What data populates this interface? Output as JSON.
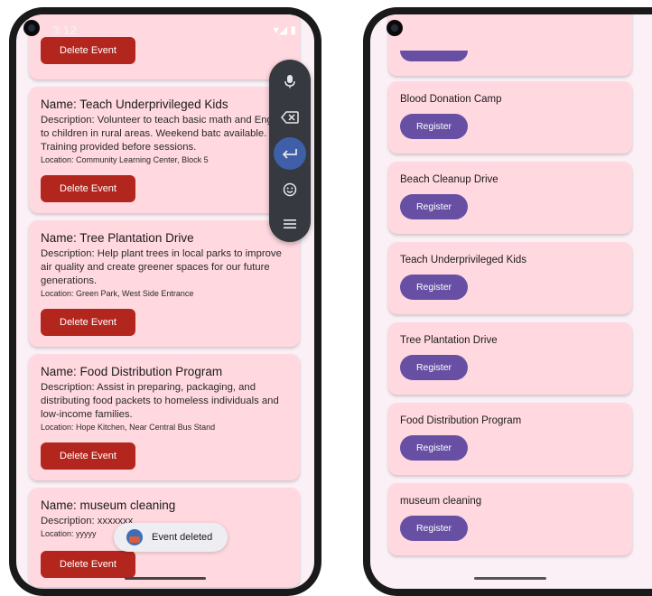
{
  "left": {
    "status_time": "3:12",
    "top_button": "Delete Event",
    "events": [
      {
        "name": "Name: Teach Underprivileged Kids",
        "description": "Description: Volunteer to teach basic math and English to children in rural areas. Weekend batc available. Training provided before sessions.",
        "location": "Location: Community Learning Center, Block 5",
        "button": "Delete Event"
      },
      {
        "name": "Name: Tree Plantation Drive",
        "description": "Description: Help plant trees in local parks to improve air quality and create greener spaces for our future generations.",
        "location": "Location: Green Park, West Side Entrance",
        "button": "Delete Event"
      },
      {
        "name": "Name: Food Distribution Program",
        "description": "Description: Assist in preparing, packaging, and distributing food packets to homeless individuals and low-income families.",
        "location": "Location: Hope Kitchen, Near Central Bus Stand",
        "button": "Delete Event"
      },
      {
        "name": "Name: museum cleaning",
        "description": "Description: xxxxxxx",
        "location": "Location: yyyyy",
        "button": "Delete Event"
      }
    ],
    "toast": "Event deleted",
    "keyboard_tools": [
      "mic-icon",
      "backspace-icon",
      "enter-icon",
      "emoji-icon",
      "menu-icon"
    ]
  },
  "right": {
    "events": [
      {
        "title": "Blood Donation Camp",
        "button": "Register"
      },
      {
        "title": "Beach Cleanup Drive",
        "button": "Register"
      },
      {
        "title": "Teach Underprivileged Kids",
        "button": "Register"
      },
      {
        "title": "Tree Plantation Drive",
        "button": "Register"
      },
      {
        "title": "Food Distribution Program",
        "button": "Register"
      },
      {
        "title": "museum cleaning",
        "button": "Register"
      }
    ]
  },
  "colors": {
    "card_bg": "#ffd8e0",
    "delete_button": "#b3261e",
    "register_button": "#6750a4",
    "screen_bg": "#fbf0f5"
  }
}
